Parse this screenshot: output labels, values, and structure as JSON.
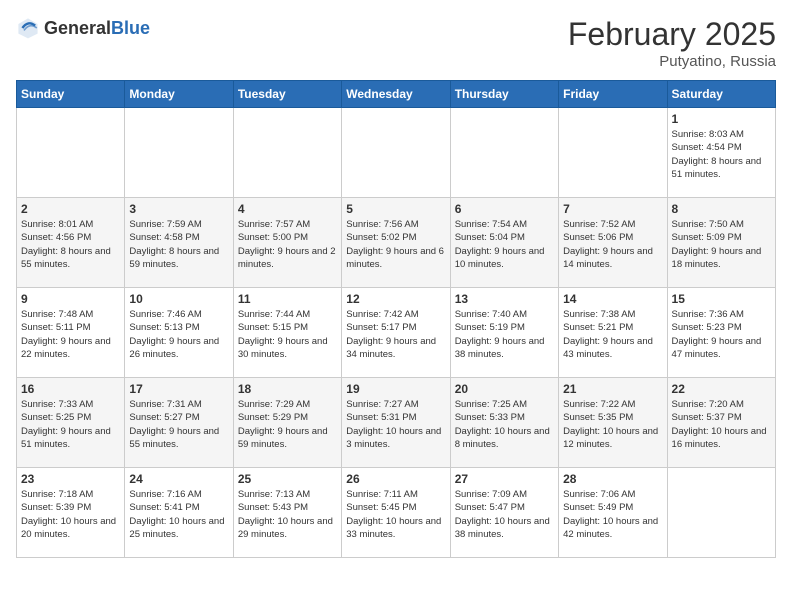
{
  "header": {
    "logo_general": "General",
    "logo_blue": "Blue",
    "title": "February 2025",
    "subtitle": "Putyatino, Russia"
  },
  "days_of_week": [
    "Sunday",
    "Monday",
    "Tuesday",
    "Wednesday",
    "Thursday",
    "Friday",
    "Saturday"
  ],
  "weeks": [
    [
      {
        "day": "",
        "sunrise": "",
        "sunset": "",
        "daylight": ""
      },
      {
        "day": "",
        "sunrise": "",
        "sunset": "",
        "daylight": ""
      },
      {
        "day": "",
        "sunrise": "",
        "sunset": "",
        "daylight": ""
      },
      {
        "day": "",
        "sunrise": "",
        "sunset": "",
        "daylight": ""
      },
      {
        "day": "",
        "sunrise": "",
        "sunset": "",
        "daylight": ""
      },
      {
        "day": "",
        "sunrise": "",
        "sunset": "",
        "daylight": ""
      },
      {
        "day": "1",
        "sunrise": "Sunrise: 8:03 AM",
        "sunset": "Sunset: 4:54 PM",
        "daylight": "Daylight: 8 hours and 51 minutes."
      }
    ],
    [
      {
        "day": "2",
        "sunrise": "Sunrise: 8:01 AM",
        "sunset": "Sunset: 4:56 PM",
        "daylight": "Daylight: 8 hours and 55 minutes."
      },
      {
        "day": "3",
        "sunrise": "Sunrise: 7:59 AM",
        "sunset": "Sunset: 4:58 PM",
        "daylight": "Daylight: 8 hours and 59 minutes."
      },
      {
        "day": "4",
        "sunrise": "Sunrise: 7:57 AM",
        "sunset": "Sunset: 5:00 PM",
        "daylight": "Daylight: 9 hours and 2 minutes."
      },
      {
        "day": "5",
        "sunrise": "Sunrise: 7:56 AM",
        "sunset": "Sunset: 5:02 PM",
        "daylight": "Daylight: 9 hours and 6 minutes."
      },
      {
        "day": "6",
        "sunrise": "Sunrise: 7:54 AM",
        "sunset": "Sunset: 5:04 PM",
        "daylight": "Daylight: 9 hours and 10 minutes."
      },
      {
        "day": "7",
        "sunrise": "Sunrise: 7:52 AM",
        "sunset": "Sunset: 5:06 PM",
        "daylight": "Daylight: 9 hours and 14 minutes."
      },
      {
        "day": "8",
        "sunrise": "Sunrise: 7:50 AM",
        "sunset": "Sunset: 5:09 PM",
        "daylight": "Daylight: 9 hours and 18 minutes."
      }
    ],
    [
      {
        "day": "9",
        "sunrise": "Sunrise: 7:48 AM",
        "sunset": "Sunset: 5:11 PM",
        "daylight": "Daylight: 9 hours and 22 minutes."
      },
      {
        "day": "10",
        "sunrise": "Sunrise: 7:46 AM",
        "sunset": "Sunset: 5:13 PM",
        "daylight": "Daylight: 9 hours and 26 minutes."
      },
      {
        "day": "11",
        "sunrise": "Sunrise: 7:44 AM",
        "sunset": "Sunset: 5:15 PM",
        "daylight": "Daylight: 9 hours and 30 minutes."
      },
      {
        "day": "12",
        "sunrise": "Sunrise: 7:42 AM",
        "sunset": "Sunset: 5:17 PM",
        "daylight": "Daylight: 9 hours and 34 minutes."
      },
      {
        "day": "13",
        "sunrise": "Sunrise: 7:40 AM",
        "sunset": "Sunset: 5:19 PM",
        "daylight": "Daylight: 9 hours and 38 minutes."
      },
      {
        "day": "14",
        "sunrise": "Sunrise: 7:38 AM",
        "sunset": "Sunset: 5:21 PM",
        "daylight": "Daylight: 9 hours and 43 minutes."
      },
      {
        "day": "15",
        "sunrise": "Sunrise: 7:36 AM",
        "sunset": "Sunset: 5:23 PM",
        "daylight": "Daylight: 9 hours and 47 minutes."
      }
    ],
    [
      {
        "day": "16",
        "sunrise": "Sunrise: 7:33 AM",
        "sunset": "Sunset: 5:25 PM",
        "daylight": "Daylight: 9 hours and 51 minutes."
      },
      {
        "day": "17",
        "sunrise": "Sunrise: 7:31 AM",
        "sunset": "Sunset: 5:27 PM",
        "daylight": "Daylight: 9 hours and 55 minutes."
      },
      {
        "day": "18",
        "sunrise": "Sunrise: 7:29 AM",
        "sunset": "Sunset: 5:29 PM",
        "daylight": "Daylight: 9 hours and 59 minutes."
      },
      {
        "day": "19",
        "sunrise": "Sunrise: 7:27 AM",
        "sunset": "Sunset: 5:31 PM",
        "daylight": "Daylight: 10 hours and 3 minutes."
      },
      {
        "day": "20",
        "sunrise": "Sunrise: 7:25 AM",
        "sunset": "Sunset: 5:33 PM",
        "daylight": "Daylight: 10 hours and 8 minutes."
      },
      {
        "day": "21",
        "sunrise": "Sunrise: 7:22 AM",
        "sunset": "Sunset: 5:35 PM",
        "daylight": "Daylight: 10 hours and 12 minutes."
      },
      {
        "day": "22",
        "sunrise": "Sunrise: 7:20 AM",
        "sunset": "Sunset: 5:37 PM",
        "daylight": "Daylight: 10 hours and 16 minutes."
      }
    ],
    [
      {
        "day": "23",
        "sunrise": "Sunrise: 7:18 AM",
        "sunset": "Sunset: 5:39 PM",
        "daylight": "Daylight: 10 hours and 20 minutes."
      },
      {
        "day": "24",
        "sunrise": "Sunrise: 7:16 AM",
        "sunset": "Sunset: 5:41 PM",
        "daylight": "Daylight: 10 hours and 25 minutes."
      },
      {
        "day": "25",
        "sunrise": "Sunrise: 7:13 AM",
        "sunset": "Sunset: 5:43 PM",
        "daylight": "Daylight: 10 hours and 29 minutes."
      },
      {
        "day": "26",
        "sunrise": "Sunrise: 7:11 AM",
        "sunset": "Sunset: 5:45 PM",
        "daylight": "Daylight: 10 hours and 33 minutes."
      },
      {
        "day": "27",
        "sunrise": "Sunrise: 7:09 AM",
        "sunset": "Sunset: 5:47 PM",
        "daylight": "Daylight: 10 hours and 38 minutes."
      },
      {
        "day": "28",
        "sunrise": "Sunrise: 7:06 AM",
        "sunset": "Sunset: 5:49 PM",
        "daylight": "Daylight: 10 hours and 42 minutes."
      },
      {
        "day": "",
        "sunrise": "",
        "sunset": "",
        "daylight": ""
      }
    ]
  ]
}
